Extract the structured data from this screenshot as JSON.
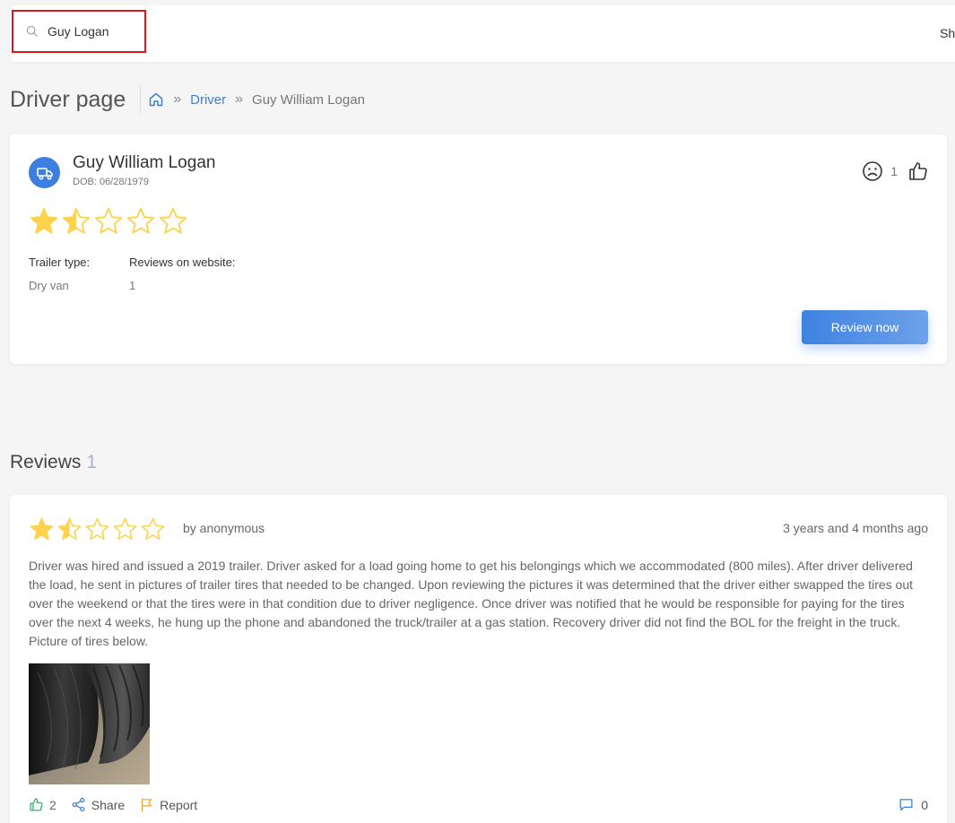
{
  "search": {
    "value": "Guy Logan"
  },
  "topbar": {
    "cut_text": "Sh"
  },
  "page": {
    "title": "Driver page"
  },
  "breadcrumb": {
    "sep": "»",
    "link": "Driver",
    "current": "Guy William Logan"
  },
  "driver": {
    "name": "Guy William Logan",
    "dob": "DOB: 06/28/1979",
    "rating": 1.5,
    "dislike_count": "1",
    "trailer_label": "Trailer type:",
    "trailer_value": "Dry van",
    "reviews_label": "Reviews on website:",
    "reviews_value": "1",
    "review_button": "Review now"
  },
  "reviews": {
    "heading": "Reviews",
    "count": "1",
    "items": [
      {
        "rating": 1.5,
        "author": "by anonymous",
        "time": "3 years and 4 months ago",
        "text": "Driver was hired and issued a 2019 trailer. Driver asked for a load going home to get his belongings which we accommodated (800 miles). After driver delivered the load, he sent in pictures of trailer tires that needed to be changed. Upon reviewing the pictures it was determined that the driver either swapped the tires out over the weekend or that the tires were in that condition due to driver negligence. Once driver was notified that he would be responsible for paying for the tires over the next 4 weeks, he hung up the phone and abandoned the truck/trailer at a gas station. Recovery driver did not find the BOL for the freight in the truck. Picture of tires below.",
        "likes": "2",
        "share_label": "Share",
        "report_label": "Report",
        "comments": "0"
      }
    ]
  },
  "colors": {
    "accent": "#3c7fd6",
    "star": "#fdd24c",
    "like_icon": "#2fb36b",
    "report_icon": "#f2a33a",
    "search_highlight": "#e0141e"
  }
}
